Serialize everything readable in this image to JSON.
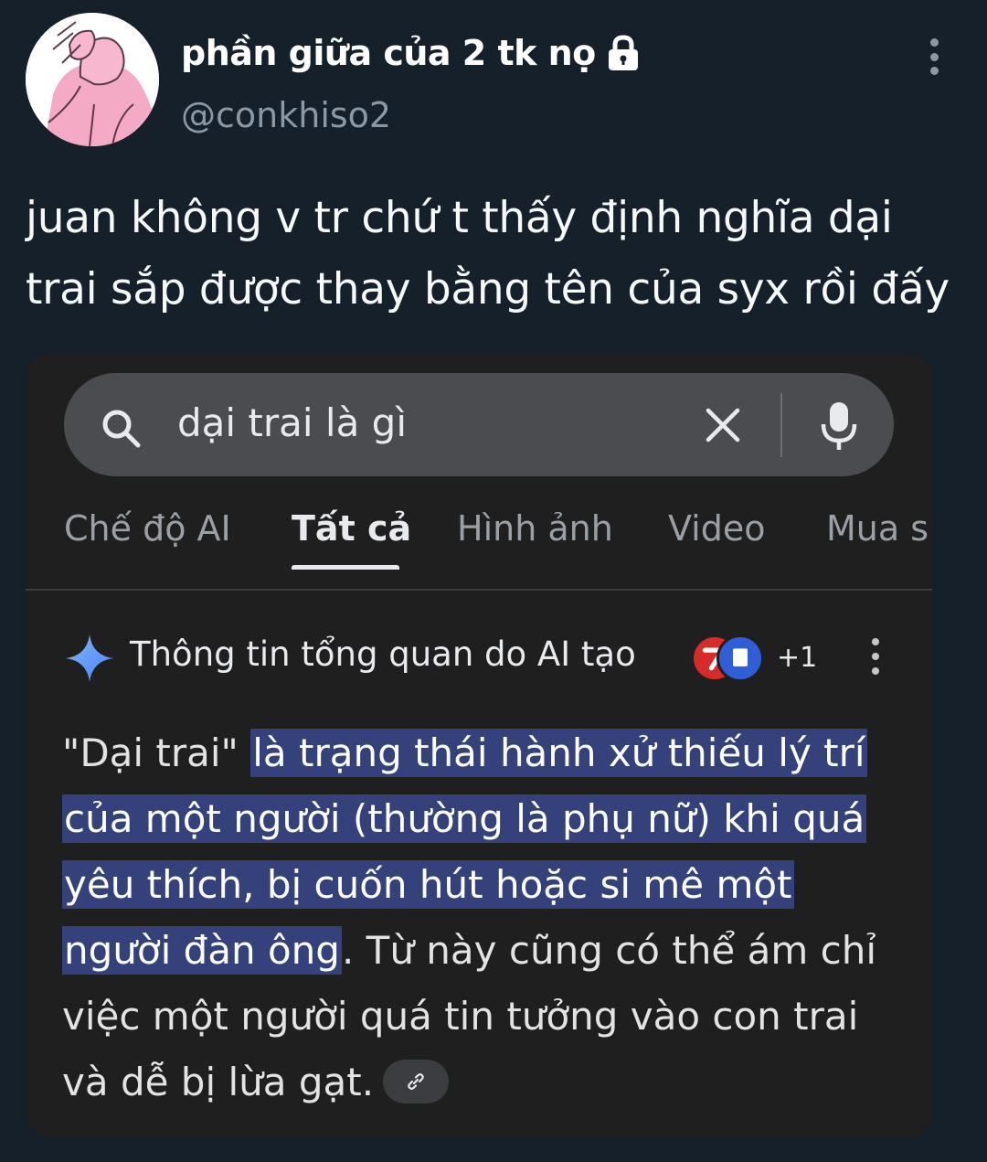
{
  "tweet": {
    "display_name": "phần giữa của 2 tk nọ",
    "handle": "@conkhiso2",
    "text_lines": [
      "juan không v tr chứ t thấy định nghĩa dại",
      "trai sắp được thay bằng tên của syx rồi đấy"
    ],
    "icons": {
      "lock": "lock-icon",
      "more": "more-vertical-icon",
      "avatar": "avatar-illustration"
    }
  },
  "search": {
    "query": "dại trai là gì",
    "icons": [
      "search-icon",
      "close-icon",
      "mic-icon"
    ]
  },
  "tabs": [
    {
      "label": "Chế độ AI",
      "active": false
    },
    {
      "label": "Tất cả",
      "active": true
    },
    {
      "label": "Hình ảnh",
      "active": false
    },
    {
      "label": "Video",
      "active": false
    },
    {
      "label": "Mua s",
      "active": false
    }
  ],
  "ai_overview": {
    "title": "Thông tin tổng quan do AI tạo",
    "sources_count": "+1",
    "body": {
      "line1_plain": "\"Dại trai\" ",
      "line1_hl": "là trạng thái hành xử thiếu lý trí",
      "line2_hl": "của một người (thường là phụ nữ) khi quá",
      "line3_hl": "yêu thích, bị cuốn hút hoặc si mê một",
      "line4_hl": "người đàn ông",
      "line4_plain": ". Từ này cũng có thể ám chỉ",
      "line5_plain": "việc một người quá tin tưởng vào con trai",
      "line6_plain": "và dễ bị lừa gạt."
    }
  },
  "colors": {
    "background": "#15202b",
    "card": "#1f1f1f",
    "search_bar": "#4a4c4f",
    "highlight": "#35417a",
    "muted_text": "#8b98a5"
  }
}
